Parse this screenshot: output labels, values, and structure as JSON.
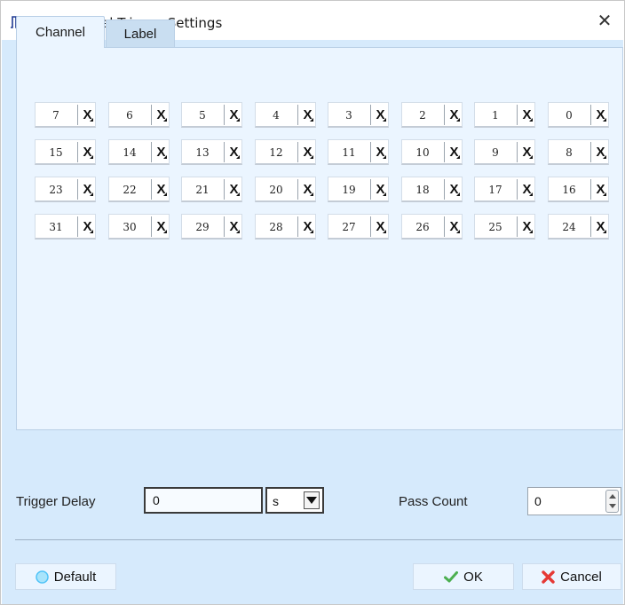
{
  "window": {
    "title": "Single Level Trigger Settings",
    "close_label": "✕"
  },
  "tabs": [
    {
      "label": "Channel",
      "active": true
    },
    {
      "label": "Label",
      "active": false
    }
  ],
  "channels": {
    "rows": [
      [
        "7",
        "6",
        "5",
        "4",
        "3",
        "2",
        "1",
        "0"
      ],
      [
        "15",
        "14",
        "13",
        "12",
        "11",
        "10",
        "9",
        "8"
      ],
      [
        "23",
        "22",
        "21",
        "20",
        "19",
        "18",
        "17",
        "16"
      ],
      [
        "31",
        "30",
        "29",
        "28",
        "27",
        "26",
        "25",
        "24"
      ]
    ],
    "state_label": "X"
  },
  "trigger_delay": {
    "label": "Trigger Delay",
    "value": "0",
    "unit": "s"
  },
  "pass_count": {
    "label": "Pass Count",
    "value": "0"
  },
  "buttons": {
    "default_label": "Default",
    "ok_label": "OK",
    "cancel_label": "Cancel"
  },
  "colors": {
    "client_bg": "#d6eafc",
    "panel_bg": "#ebf5ff",
    "ok_check": "#4caf50",
    "cancel_x": "#e53935",
    "default_radio": "#4fc3f7"
  }
}
